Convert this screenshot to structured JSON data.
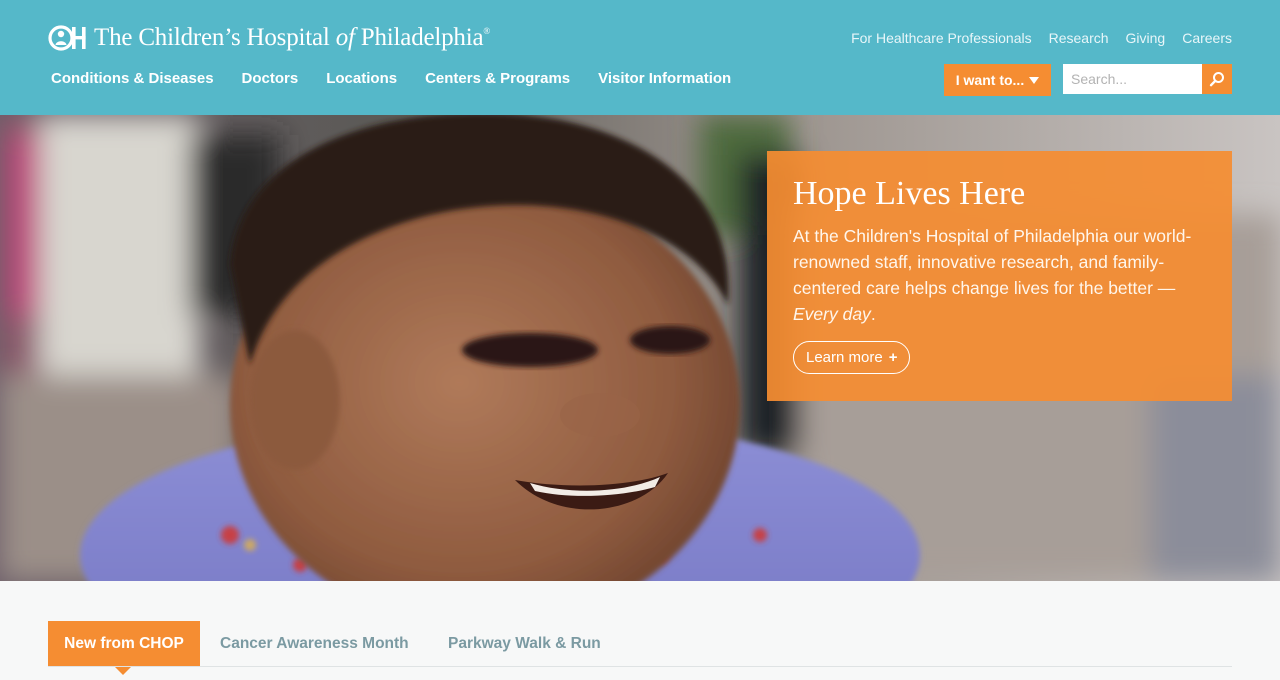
{
  "header": {
    "logo": {
      "name_pre": "The Children’s Hospital ",
      "name_of": "of",
      "name_post": " Philadelphia",
      "registered": "®",
      "mark": "CH"
    },
    "utility_nav": [
      {
        "label": "For Healthcare Professionals"
      },
      {
        "label": "Research"
      },
      {
        "label": "Giving"
      },
      {
        "label": "Careers"
      }
    ],
    "main_nav": [
      {
        "label": "Conditions & Diseases"
      },
      {
        "label": "Doctors"
      },
      {
        "label": "Locations"
      },
      {
        "label": "Centers & Programs"
      },
      {
        "label": "Visitor Information"
      }
    ],
    "iwant_label": "I want to...",
    "search": {
      "placeholder": "Search..."
    }
  },
  "hero": {
    "title": "Hope Lives Here",
    "body": "At the Children's Hospital of Philadelphia our world-renowned staff, innovative research, and family-centered care helps change lives for the better — ",
    "body_em": "Every day",
    "body_end": ".",
    "cta_label": "Learn more",
    "cta_icon": "+"
  },
  "tabs": [
    {
      "label": "New from CHOP",
      "active": true
    },
    {
      "label": "Cancer Awareness Month",
      "active": false
    },
    {
      "label": "Parkway Walk & Run",
      "active": false
    }
  ],
  "colors": {
    "header_bg": "#55b8c9",
    "accent": "#f58d32",
    "tab_inactive_text": "#7b9aa2"
  },
  "icons": {
    "logo": "chop-logo-icon",
    "dropdown": "caret-down-icon",
    "search": "search-icon",
    "cta": "plus-icon"
  }
}
